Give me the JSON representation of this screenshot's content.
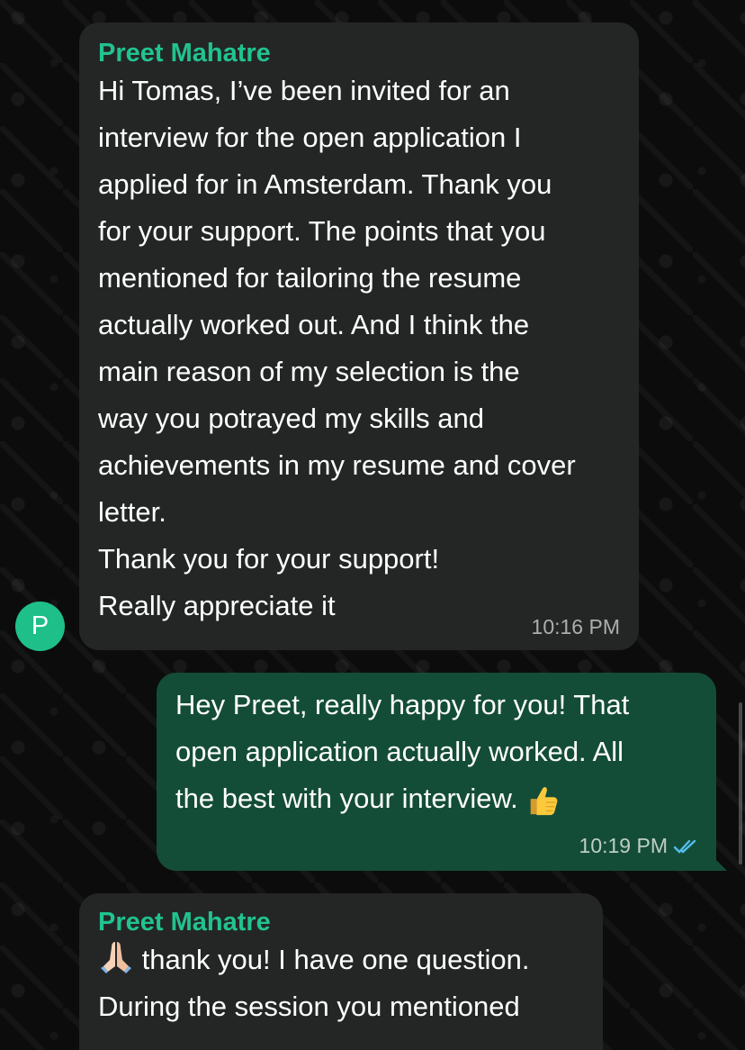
{
  "contact": {
    "name": "Preet Mahatre",
    "avatar_letter": "P",
    "avatar_color": "#1fbf8a",
    "name_color": "#21c38f"
  },
  "messages": [
    {
      "direction": "incoming",
      "sender": "Preet Mahatre",
      "text": "Hi Tomas, I’ve been invited for an\ninterview for the open application I\napplied for in Amsterdam. Thank you\nfor your support. The points that you\nmentioned for tailoring the resume\nactually worked out. And I think the\nmain reason of my selection is the\nway you potrayed my skills and\nachievements in my resume and cover\nletter.\nThank you for your support!\nReally appreciate it",
      "time": "10:16 PM"
    },
    {
      "direction": "outgoing",
      "text": "Hey Preet, really happy for you! That\nopen application actually worked. All\nthe best with your interview.",
      "emoji": "thumbs-up-icon",
      "time": "10:19 PM",
      "status": "read"
    },
    {
      "direction": "incoming",
      "sender": "Preet Mahatre",
      "emoji": "folded-hands-icon",
      "text": " thank you! I have one question.\nDuring the session you mentioned",
      "time": ""
    }
  ],
  "colors": {
    "incoming_bubble": "#242626",
    "outgoing_bubble": "#144d37",
    "read_tick": "#53bdeb"
  }
}
